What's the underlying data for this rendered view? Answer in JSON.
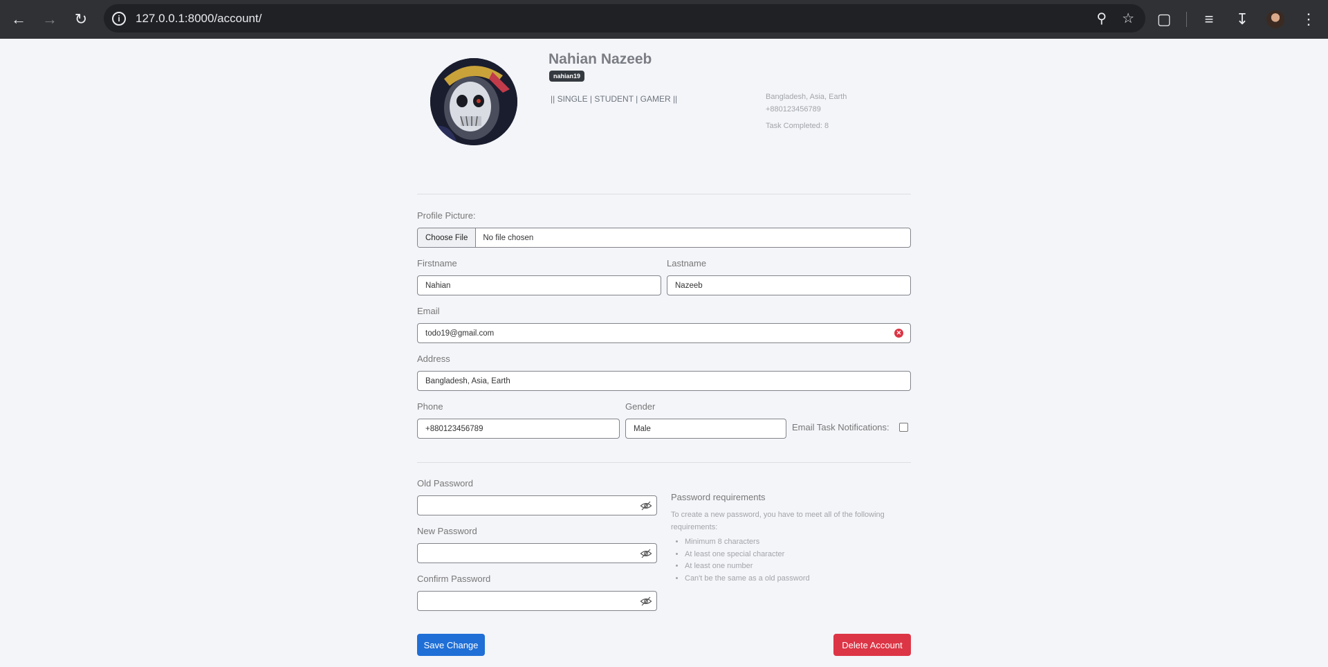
{
  "browser": {
    "url": "127.0.0.1:8000/account/"
  },
  "profile": {
    "name": "Nahian Nazeeb",
    "username": "nahian19",
    "bio": "|| SINGLE | STUDENT | GAMER ||",
    "location": "Bangladesh, Asia, Earth",
    "phone": "+880123456789",
    "tasks_completed": "Task Completed: 8"
  },
  "form": {
    "profile_picture_label": "Profile Picture:",
    "choose_file_label": "Choose File",
    "file_status": "No file chosen",
    "firstname_label": "Firstname",
    "firstname_value": "Nahian",
    "lastname_label": "Lastname",
    "lastname_value": "Nazeeb",
    "email_label": "Email",
    "email_value": "todo19@gmail.com",
    "address_label": "Address",
    "address_value": "Bangladesh, Asia, Earth",
    "phone_label": "Phone",
    "phone_value": "+880123456789",
    "gender_label": "Gender",
    "gender_value": "Male",
    "email_notifications_label": "Email Task Notifications:"
  },
  "password": {
    "old_label": "Old Password",
    "new_label": "New Password",
    "confirm_label": "Confirm Password",
    "requirements_title": "Password requirements",
    "requirements_desc": "To create a new password, you have to meet all of the following requirements:",
    "requirements": [
      "Minimum 8 characters",
      "At least one special character",
      "At least one number",
      "Can't be the same as a old password"
    ]
  },
  "actions": {
    "save_label": "Save Change",
    "delete_label": "Delete Account"
  },
  "colors": {
    "save": "#1f6fd6",
    "delete": "#dc3545",
    "error": "#dc3545"
  }
}
